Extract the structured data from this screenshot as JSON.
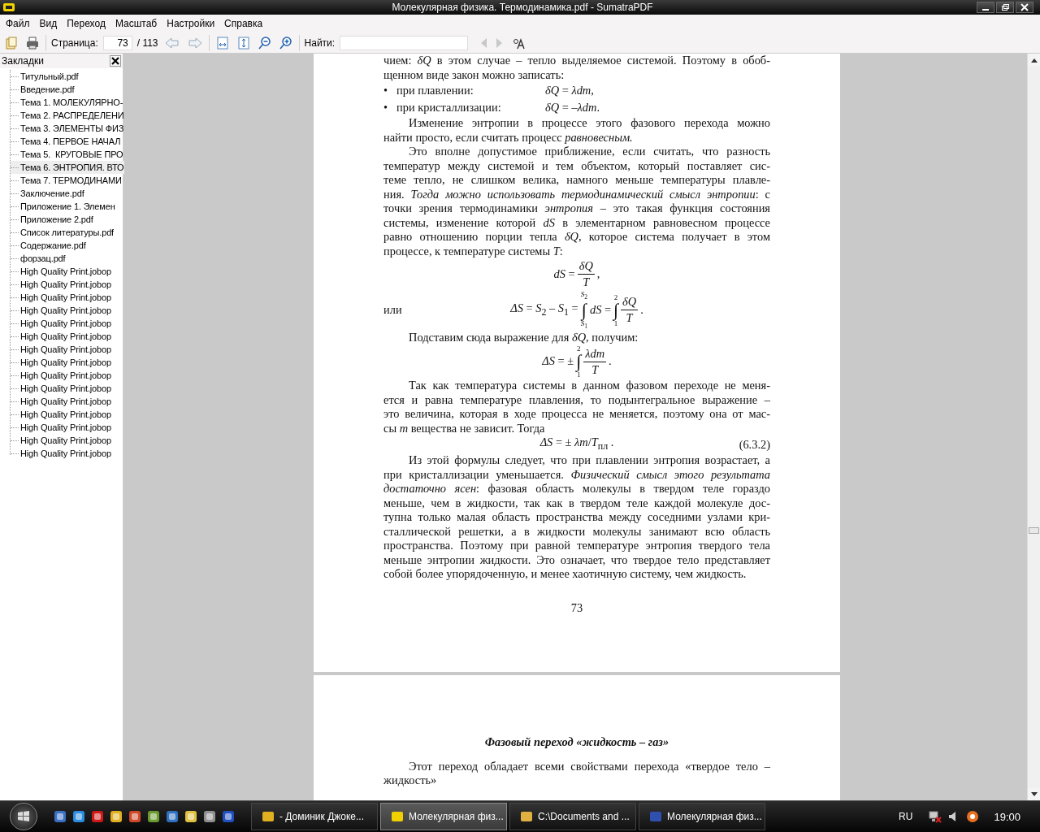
{
  "window": {
    "title": "Молекулярная физика. Термодинамика.pdf - SumatraPDF"
  },
  "menu": [
    "Файл",
    "Вид",
    "Переход",
    "Масштаб",
    "Настройки",
    "Справка"
  ],
  "toolbar": {
    "page_label": "Страница:",
    "page_value": "73",
    "page_total": "/ 113",
    "find_label": "Найти:"
  },
  "bookmarks": {
    "title": "Закладки",
    "items": [
      {
        "label": "Титульный.pdf",
        "selected": false
      },
      {
        "label": "Введение.pdf",
        "selected": false
      },
      {
        "label": "Тема 1. МОЛЕКУЛЯРНО-",
        "selected": false
      },
      {
        "label": "Тема 2. РАСПРЕДЕЛЕНИ",
        "selected": false
      },
      {
        "label": "Тема 3. ЭЛЕМЕНТЫ ФИЗ",
        "selected": false
      },
      {
        "label": "Тема 4. ПЕРВОЕ НАЧАЛ",
        "selected": false
      },
      {
        "label": "Тема 5.  КРУГОВЫЕ ПРО",
        "selected": false
      },
      {
        "label": "Тема 6. ЭНТРОПИЯ. ВТО",
        "selected": true
      },
      {
        "label": "Тема 7. ТЕРМОДИНАМИ",
        "selected": false
      },
      {
        "label": "Заключение.pdf",
        "selected": false
      },
      {
        "label": "Приложение 1. Элемен",
        "selected": false
      },
      {
        "label": "Приложение 2.pdf",
        "selected": false
      },
      {
        "label": "Список литературы.pdf",
        "selected": false
      },
      {
        "label": "Содержание.pdf",
        "selected": false
      },
      {
        "label": "форзац.pdf",
        "selected": false
      },
      {
        "label": "High Quality Print.jobop",
        "selected": false
      },
      {
        "label": "High Quality Print.jobop",
        "selected": false
      },
      {
        "label": "High Quality Print.jobop",
        "selected": false
      },
      {
        "label": "High Quality Print.jobop",
        "selected": false
      },
      {
        "label": "High Quality Print.jobop",
        "selected": false
      },
      {
        "label": "High Quality Print.jobop",
        "selected": false
      },
      {
        "label": "High Quality Print.jobop",
        "selected": false
      },
      {
        "label": "High Quality Print.jobop",
        "selected": false
      },
      {
        "label": "High Quality Print.jobop",
        "selected": false
      },
      {
        "label": "High Quality Print.jobop",
        "selected": false
      },
      {
        "label": "High Quality Print.jobop",
        "selected": false
      },
      {
        "label": "High Quality Print.jobop",
        "selected": false
      },
      {
        "label": "High Quality Print.jobop",
        "selected": false
      },
      {
        "label": "High Quality Print.jobop",
        "selected": false
      },
      {
        "label": "High Quality Print.jobop",
        "selected": false
      }
    ]
  },
  "document": {
    "pages": [
      {
        "blocks": [
          {
            "kind": "paragraph",
            "indent": false,
            "lines": [
              "чием: *δQ* в этом случае – тепло выделяемое системой. Поэтому в обоб-",
              "щенном виде закон можно записать:"
            ]
          },
          {
            "kind": "bullet",
            "mark": "•",
            "label": "при плавлении:",
            "formula": "*δQ* = *λdm*,"
          },
          {
            "kind": "bullet",
            "mark": "•",
            "label": "при кристаллизации:",
            "formula": "*δQ* = –*λdm*."
          },
          {
            "kind": "paragraph",
            "indent": true,
            "lines": [
              "Изменение энтропии в процессе этого фазового перехода можно",
              "найти просто, если считать процесс *равновесным.*"
            ]
          },
          {
            "kind": "paragraph",
            "indent": true,
            "lines": [
              "Это вполне допустимое приближение, если считать, что разность",
              "температур между системой и тем объектом, который поставляет сис-",
              "теме тепло, не слишком велика, намного меньше температуры плавле-",
              "ния. *Тогда можно использовать термодинамический смысл энтропии*: с",
              "точки зрения термодинамики *энтропия* – это такая функция состояния",
              "системы, изменение которой *dS* в элементарном равновесном процессе",
              "равно отношению порции тепла *δQ*, которое система получает в этом",
              "процессе, к температуре системы *T*:"
            ]
          },
          {
            "kind": "formula",
            "parts": [
              {
                "kind": "text",
                "s": "*dS* ="
              },
              {
                "kind": "frac",
                "num": "*δQ*",
                "den": "*T*"
              },
              {
                "kind": "text",
                "s": ","
              }
            ]
          },
          {
            "kind": "formula",
            "lead": "или",
            "parts": [
              {
                "kind": "text",
                "s": "*ΔS* = *S*$_{2}$ – *S*$_{1}$ ="
              },
              {
                "kind": "int",
                "sign": "∫",
                "up": "*S*$_{2}$",
                "low": "*S*$_{1}$"
              },
              {
                "kind": "text",
                "s": "*dS* ="
              },
              {
                "kind": "int",
                "sign": "∫",
                "up": "2",
                "low": "1"
              },
              {
                "kind": "frac",
                "num": "*δQ*",
                "den": "*T*"
              },
              {
                "kind": "text",
                "s": "."
              }
            ]
          },
          {
            "kind": "paragraph",
            "indent": true,
            "lines": [
              "Подставим сюда выражение для *δQ*, получим:"
            ]
          },
          {
            "kind": "formula",
            "parts": [
              {
                "kind": "text",
                "s": "*ΔS* = ±"
              },
              {
                "kind": "int",
                "sign": "∫",
                "up": "2",
                "low": "1"
              },
              {
                "kind": "frac",
                "num": "*λdm*",
                "den": "*T*"
              },
              {
                "kind": "text",
                "s": "."
              }
            ]
          },
          {
            "kind": "paragraph",
            "indent": true,
            "lines": [
              "Так как температура системы в данном фазовом переходе не меня-",
              "ется и равна температуре плавления, то подынтегральное выражение –",
              "это величина, которая в ходе процесса не меняется, поэтому она от мас-",
              "сы *m* вещества не зависит. Тогда"
            ]
          },
          {
            "kind": "formula",
            "number": "(6.3.2)",
            "parts": [
              {
                "kind": "text",
                "s": "*ΔS* = ± *λm*/*T*$_{пл}$ ."
              }
            ]
          },
          {
            "kind": "paragraph",
            "indent": true,
            "lines": [
              "Из этой формулы следует, что при плавлении энтропия возрастает, а",
              "при кристаллизации уменьшается. *Физический смысл этого результата*",
              "*достаточно ясен*: фазовая область молекулы в твердом теле гораздо",
              "меньше, чем в жидкости, так как в твердом теле каждой молекуле дос-",
              "тупна только малая область пространства между соседними узлами кри-",
              "сталлической решетки, а в жидкости молекулы занимают всю область",
              "пространства. Поэтому при равной температуре энтропия твердого тела",
              "меньше энтропии жидкости. Это означает, что твердое тело представляет",
              "собой более упорядоченную, и менее хаотичную систему, чем жидкость."
            ]
          },
          {
            "kind": "page_number",
            "text": "73"
          }
        ]
      },
      {
        "blocks": [
          {
            "kind": "heading",
            "text": "Фазовый переход «жидкость – газ»"
          },
          {
            "kind": "paragraph",
            "indent": true,
            "lines": [
              "Этот переход обладает всеми свойствами перехода «твердое тело –",
              "жидкость»"
            ]
          }
        ]
      }
    ]
  },
  "taskbar": {
    "tasks": [
      {
        "label": "- Доминик Джоке...",
        "selected": false
      },
      {
        "label": "Молекулярная физ...",
        "selected": true
      },
      {
        "label": "C:\\Documents and ...",
        "selected": false
      },
      {
        "label": "Молекулярная физ...",
        "selected": false
      }
    ],
    "language": "RU",
    "time": "19:00"
  }
}
